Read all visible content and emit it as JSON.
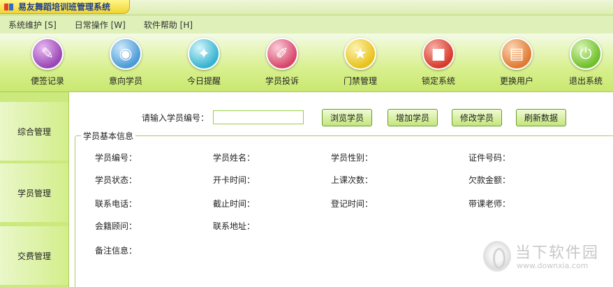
{
  "window": {
    "title": "易友舞蹈培训班管理系统"
  },
  "menu": [
    "系统维护 [S]",
    "日常操作 [W]",
    "软件帮助 [H]"
  ],
  "toolbar": [
    {
      "label": "便签记录",
      "icon": "notes-icon",
      "color": "#9a47b5"
    },
    {
      "label": "意向学员",
      "icon": "cd-icon",
      "color": "#4a9bd6"
    },
    {
      "label": "今日提醒",
      "icon": "gift-icon",
      "color": "#35b3cf"
    },
    {
      "label": "学员投诉",
      "icon": "pen-icon",
      "color": "#d8456a"
    },
    {
      "label": "门禁管理",
      "icon": "star-icon",
      "color": "#e8c21c"
    },
    {
      "label": "锁定系统",
      "icon": "box-icon",
      "color": "#d83a2a"
    },
    {
      "label": "更换用户",
      "icon": "document-icon",
      "color": "#e07a30"
    },
    {
      "label": "退出系统",
      "icon": "exit-icon",
      "color": "#6fbf2a"
    }
  ],
  "nav": [
    "综合管理",
    "学员管理",
    "交费管理"
  ],
  "search": {
    "label": "请输入学员编号：",
    "value": ""
  },
  "buttons": {
    "browse": "浏览学员",
    "add": "增加学员",
    "edit": "修改学员",
    "refresh": "刷新数据"
  },
  "info": {
    "legend": "学员基本信息",
    "fields": {
      "id": "学员编号：",
      "name": "学员姓名：",
      "gender": "学员性别：",
      "cert": "证件号码：",
      "status": "学员状态：",
      "card_time": "开卡时间：",
      "class_count": "上课次数：",
      "debt": "欠款金额：",
      "phone": "联系电话：",
      "end_time": "截止时间：",
      "reg_time": "登记时间：",
      "teacher": "带课老师：",
      "advisor": "会籍顾问：",
      "address": "联系地址：",
      "remark": "备注信息："
    }
  },
  "watermark": {
    "text": "当下软件园",
    "url": "www.downxia.com"
  }
}
